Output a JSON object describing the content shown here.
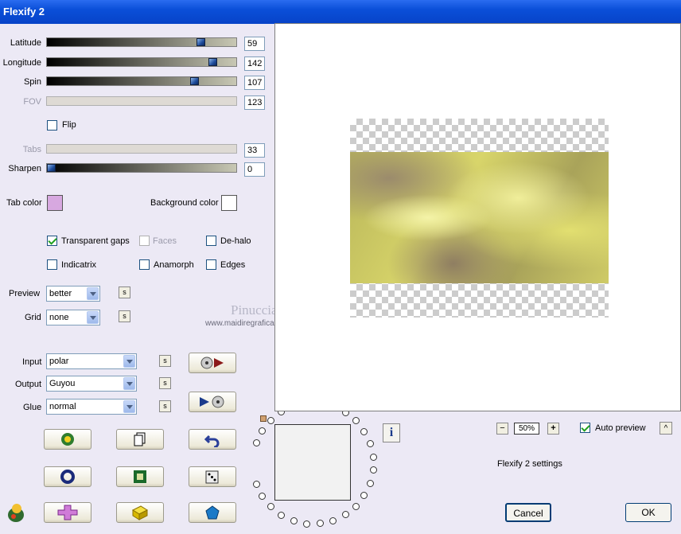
{
  "window": {
    "title": "Flexify 2"
  },
  "sliders": [
    {
      "label": "Latitude",
      "value": "59",
      "enabled": true,
      "fraction": 0.82
    },
    {
      "label": "Longitude",
      "value": "142",
      "enabled": true,
      "fraction": 0.87
    },
    {
      "label": "Spin",
      "value": "107",
      "enabled": true,
      "fraction": 0.78
    },
    {
      "label": "FOV",
      "value": "123",
      "enabled": false
    },
    {
      "label": "Tabs",
      "value": "33",
      "enabled": false
    },
    {
      "label": "Sharpen",
      "value": "0",
      "enabled": true,
      "fraction": 0.0
    }
  ],
  "flip": {
    "label": "Flip",
    "checked": false
  },
  "tab_color": {
    "label": "Tab color",
    "color": "#d7a8e0"
  },
  "background_color": {
    "label": "Background color",
    "color": "#ffffff"
  },
  "checkboxes": {
    "transparent_gaps": {
      "label": "Transparent gaps",
      "checked": true
    },
    "faces": {
      "label": "Faces",
      "checked": false,
      "enabled": false
    },
    "de_halo": {
      "label": "De-halo",
      "checked": false
    },
    "indicatrix": {
      "label": "Indicatrix",
      "checked": false
    },
    "anamorph": {
      "label": "Anamorph",
      "checked": false
    },
    "edges": {
      "label": "Edges",
      "checked": false
    }
  },
  "preview": {
    "label": "Preview",
    "value": "better"
  },
  "grid": {
    "label": "Grid",
    "value": "none"
  },
  "input": {
    "label": "Input",
    "value": "polar"
  },
  "output": {
    "label": "Output",
    "value": "Guyou"
  },
  "glue": {
    "label": "Glue",
    "value": "normal"
  },
  "s_button_label": "s",
  "watermark": {
    "name": "Pinuccia",
    "url": "www.maidiregrafica.eu"
  },
  "zoom": {
    "value": "50%",
    "minus": "−",
    "plus": "+"
  },
  "auto_preview": {
    "label": "Auto preview",
    "checked": true
  },
  "settings_label": "Flexify 2 settings",
  "buttons": {
    "cancel": "Cancel",
    "ok": "OK",
    "collapse": "^"
  },
  "info_label": "i"
}
